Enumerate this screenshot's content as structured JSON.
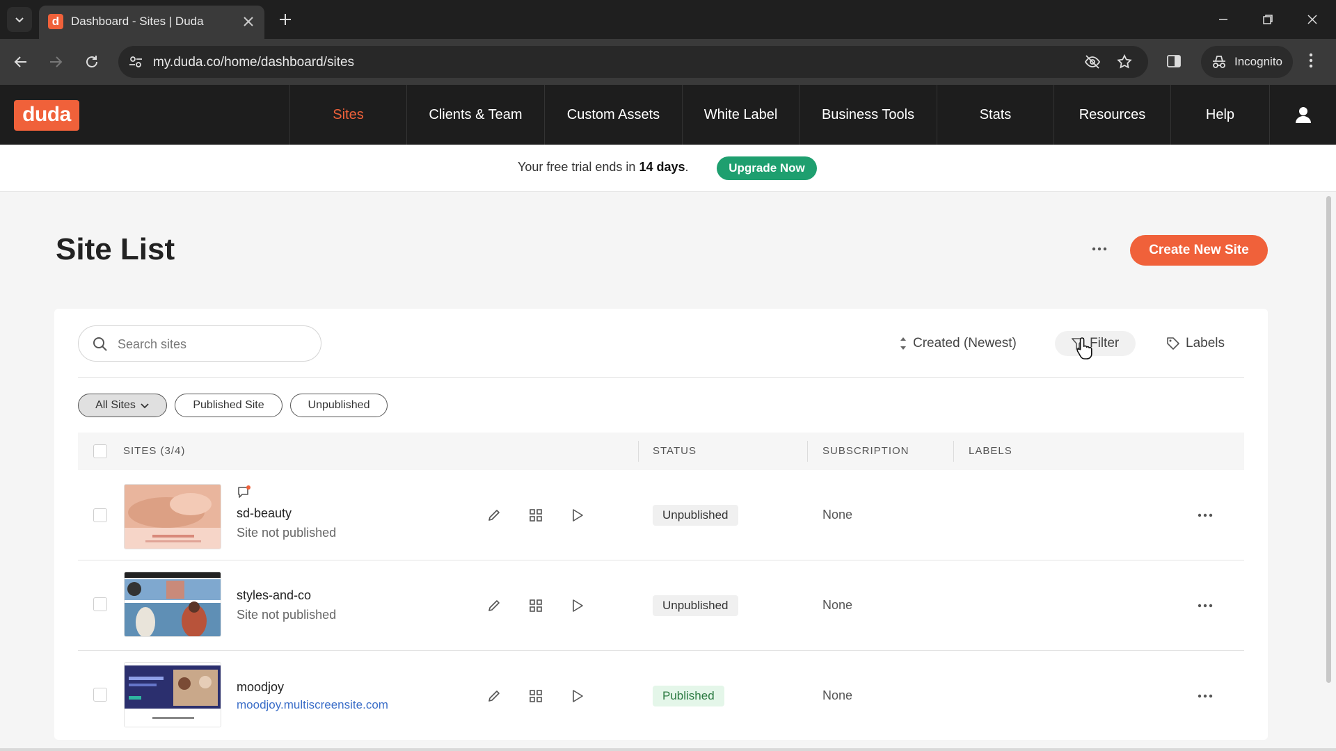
{
  "browser": {
    "tab_title": "Dashboard - Sites | Duda",
    "tab_favicon_letter": "d",
    "url": "my.duda.co/home/dashboard/sites",
    "incognito_label": "Incognito"
  },
  "app": {
    "logo_text": "duda",
    "brand_color": "#f0613a",
    "nav_items": [
      "Sites",
      "Clients & Team",
      "Custom Assets",
      "White Label",
      "Business Tools",
      "Stats",
      "Resources",
      "Help"
    ],
    "active_nav": "Sites"
  },
  "trial_banner": {
    "text_before": "Your free trial ends in",
    "days": "14 days",
    "text_after": ".",
    "upgrade_label": "Upgrade Now",
    "upgrade_color": "#1e9f6f"
  },
  "page": {
    "title": "Site List",
    "create_label": "Create New Site"
  },
  "toolbar": {
    "search_placeholder": "Search sites",
    "sort_label": "Created (Newest)",
    "filter_label": "Filter",
    "labels_label": "Labels"
  },
  "chips": [
    "All Sites",
    "Published Site",
    "Unpublished"
  ],
  "table": {
    "headers": {
      "sites": "SITES (3/4)",
      "status": "STATUS",
      "subscription": "SUBSCRIPTION",
      "labels": "LABELS"
    },
    "rows": [
      {
        "name": "sd-beauty",
        "subtitle": "Site not published",
        "status": "Unpublished",
        "subscription": "None"
      },
      {
        "name": "styles-and-co",
        "subtitle": "Site not published",
        "status": "Unpublished",
        "subscription": "None"
      },
      {
        "name": "moodjoy",
        "subtitle": "moodjoy.multiscreensite.com",
        "status": "Published",
        "subscription": "None"
      }
    ]
  },
  "icons": [
    "tab-search-icon",
    "close-icon",
    "plus-icon",
    "back-icon",
    "forward-icon",
    "reload-icon",
    "site-info-icon",
    "eye-off-icon",
    "star-icon",
    "side-panel-icon",
    "incognito-icon",
    "kebab-icon",
    "user-icon",
    "search-icon",
    "sort-icon",
    "filter-icon",
    "tag-icon",
    "edit-icon",
    "grid-icon",
    "play-icon",
    "more-icon"
  ]
}
